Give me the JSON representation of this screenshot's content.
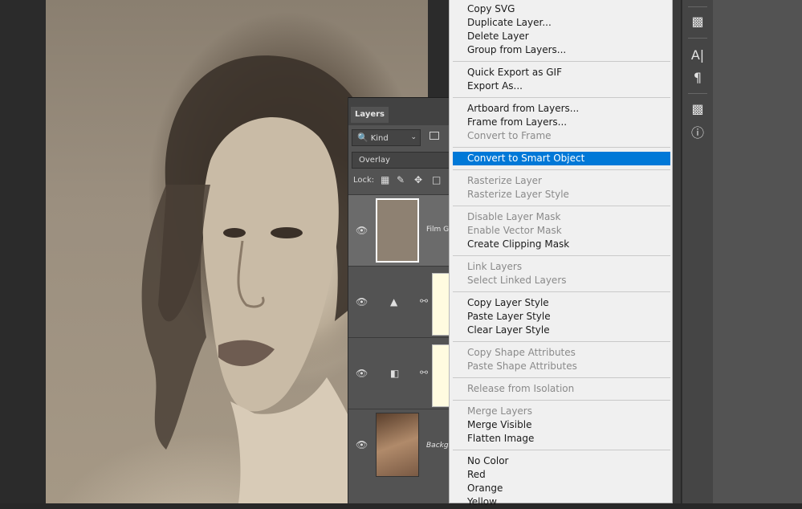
{
  "layers_panel": {
    "tab_label": "Layers",
    "kind_filter": "Kind",
    "blend_mode": "Overlay",
    "lock_label": "Lock:",
    "layers": [
      {
        "name": "Film Gr",
        "type": "fill",
        "color": "#8e8172",
        "selected": true
      },
      {
        "name": "",
        "type": "levels-adjustment",
        "mask_color": "#fffbe0"
      },
      {
        "name": "",
        "type": "gradient-map-adjustment",
        "mask_color": "#fffbe0"
      },
      {
        "name": "Backgr",
        "type": "image",
        "italic": true
      }
    ]
  },
  "context_menu": {
    "items": [
      {
        "label": "Copy SVG",
        "enabled": true
      },
      {
        "label": "Duplicate Layer...",
        "enabled": true
      },
      {
        "label": "Delete Layer",
        "enabled": true
      },
      {
        "label": "Group from Layers...",
        "enabled": true
      },
      {
        "sep": true
      },
      {
        "label": "Quick Export as GIF",
        "enabled": true
      },
      {
        "label": "Export As...",
        "enabled": true
      },
      {
        "sep": true
      },
      {
        "label": "Artboard from Layers...",
        "enabled": true
      },
      {
        "label": "Frame from Layers...",
        "enabled": true
      },
      {
        "label": "Convert to Frame",
        "enabled": false
      },
      {
        "sep": true
      },
      {
        "label": "Convert to Smart Object",
        "enabled": true,
        "highlighted": true
      },
      {
        "sep": true
      },
      {
        "label": "Rasterize Layer",
        "enabled": false
      },
      {
        "label": "Rasterize Layer Style",
        "enabled": false
      },
      {
        "sep": true
      },
      {
        "label": "Disable Layer Mask",
        "enabled": false
      },
      {
        "label": "Enable Vector Mask",
        "enabled": false
      },
      {
        "label": "Create Clipping Mask",
        "enabled": true
      },
      {
        "sep": true
      },
      {
        "label": "Link Layers",
        "enabled": false
      },
      {
        "label": "Select Linked Layers",
        "enabled": false
      },
      {
        "sep": true
      },
      {
        "label": "Copy Layer Style",
        "enabled": true
      },
      {
        "label": "Paste Layer Style",
        "enabled": true
      },
      {
        "label": "Clear Layer Style",
        "enabled": true
      },
      {
        "sep": true
      },
      {
        "label": "Copy Shape Attributes",
        "enabled": false
      },
      {
        "label": "Paste Shape Attributes",
        "enabled": false
      },
      {
        "sep": true
      },
      {
        "label": "Release from Isolation",
        "enabled": false
      },
      {
        "sep": true
      },
      {
        "label": "Merge Layers",
        "enabled": false
      },
      {
        "label": "Merge Visible",
        "enabled": true
      },
      {
        "label": "Flatten Image",
        "enabled": true
      },
      {
        "sep": true
      },
      {
        "label": "No Color",
        "enabled": true
      },
      {
        "label": "Red",
        "enabled": true
      },
      {
        "label": "Orange",
        "enabled": true
      },
      {
        "label": "Yellow",
        "enabled": true
      }
    ]
  },
  "toolbar_icons": [
    "clone-source-icon",
    "character-icon",
    "paragraph-icon",
    "3d-materials-icon",
    "info-icon"
  ],
  "colors": {
    "menu_highlight": "#0078d7",
    "panel_bg": "#535353",
    "canvas_bg": "#2b2b2b"
  }
}
